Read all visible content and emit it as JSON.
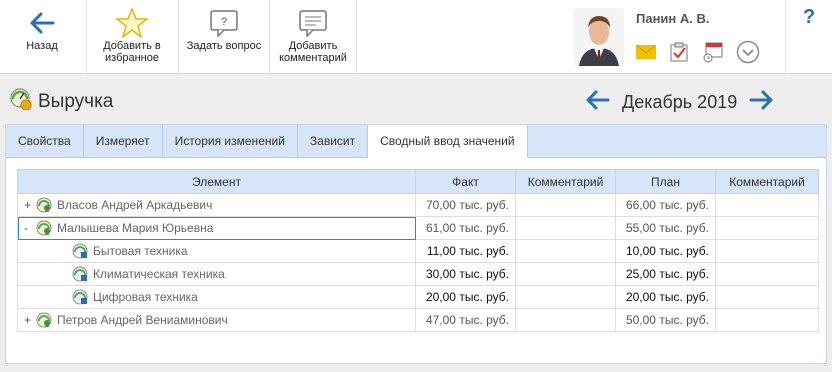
{
  "toolbar": {
    "back_label": "Назад",
    "favorite_label": "Добавить в избранное",
    "question_label": "Задать вопрос",
    "comment_label": "Добавить комментарий"
  },
  "user": {
    "name": "Панин А. В."
  },
  "help_label": "?",
  "page": {
    "title": "Выручка",
    "period": "Декабрь 2019"
  },
  "tabs": [
    {
      "label": "Свойства"
    },
    {
      "label": "Измеряет"
    },
    {
      "label": "История изменений"
    },
    {
      "label": "Зависит"
    },
    {
      "label": "Сводный ввод значений"
    }
  ],
  "table": {
    "headers": [
      "Элемент",
      "Факт",
      "Комментарий",
      "План",
      "Комментарий"
    ],
    "rows": [
      {
        "expander": "+",
        "name": "Власов Андрей Аркадьевич",
        "fact": "70,00 тыс. руб.",
        "fact_comment": "",
        "plan": "66,00 тыс. руб.",
        "plan_comment": ""
      },
      {
        "expander": "-",
        "name": "Малышева Мария Юрьевна",
        "fact": "61,00 тыс. руб.",
        "fact_comment": "",
        "plan": "55,00 тыс. руб.",
        "plan_comment": ""
      },
      {
        "expander": "",
        "name": "Бытовая техника",
        "fact": "11,00 тыс. руб.",
        "fact_comment": "",
        "plan": "10,00 тыс. руб.",
        "plan_comment": ""
      },
      {
        "expander": "",
        "name": "Климатическая техника",
        "fact": "30,00 тыс. руб.",
        "fact_comment": "",
        "plan": "25,00 тыс. руб.",
        "plan_comment": ""
      },
      {
        "expander": "",
        "name": "Цифровая техника",
        "fact": "20,00 тыс. руб.",
        "fact_comment": "",
        "plan": "20,00 тыс. руб.",
        "plan_comment": ""
      },
      {
        "expander": "+",
        "name": "Петров Андрей Вениаминович",
        "fact": "47,00 тыс. руб.",
        "fact_comment": "",
        "plan": "50,00 тыс. руб.",
        "plan_comment": ""
      }
    ]
  },
  "colors": {
    "accent": "#2a6fb5",
    "tab_bar": "#d6e5f7",
    "mail": "#f2c200",
    "task": "#d9342b"
  }
}
